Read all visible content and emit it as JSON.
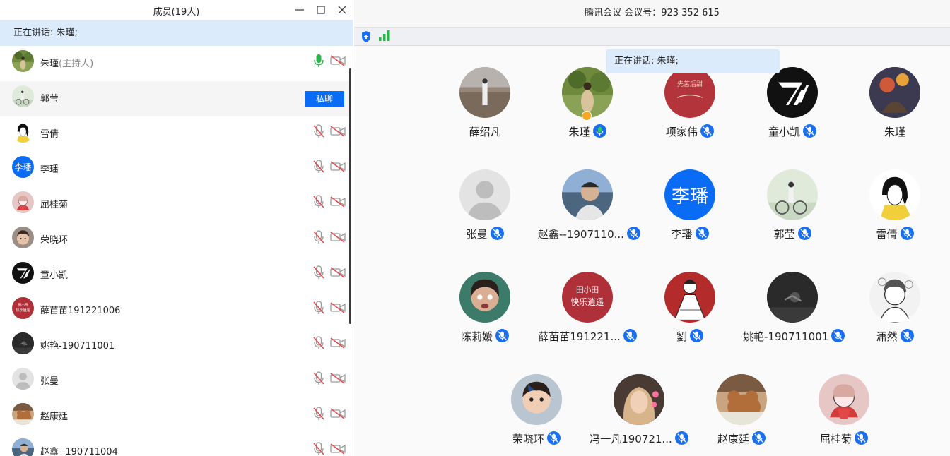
{
  "members_panel": {
    "title": "成员(19人)",
    "speaking": "正在讲话: 朱瑾;",
    "chat_button": "私聊",
    "members": [
      {
        "name": "朱瑾",
        "role": "(主持人)",
        "avatar": "photo-field",
        "mic": "active",
        "cam": "off"
      },
      {
        "name": "郭莹",
        "role": "",
        "avatar": "photo-bike",
        "mic": "none",
        "cam": "none",
        "chat": true
      },
      {
        "name": "雷倩",
        "role": "",
        "avatar": "drawing-girl-yellow",
        "mic": "off",
        "cam": "off"
      },
      {
        "name": "李璠",
        "role": "",
        "avatar": "initials",
        "initials": "李璠",
        "mic": "off",
        "cam": "off"
      },
      {
        "name": "屈桂菊",
        "role": "",
        "avatar": "drawing-pink",
        "mic": "off",
        "cam": "off"
      },
      {
        "name": "荣晓环",
        "role": "",
        "avatar": "photo-child-face",
        "mic": "off",
        "cam": "off"
      },
      {
        "name": "童小凯",
        "role": "",
        "avatar": "logo-black",
        "mic": "off",
        "cam": "off"
      },
      {
        "name": "薛苗苗191221006",
        "role": "",
        "avatar": "red-card",
        "mic": "off",
        "cam": "off"
      },
      {
        "name": "姚艳-190711001",
        "role": "",
        "avatar": "dark-photo",
        "mic": "off",
        "cam": "off"
      },
      {
        "name": "张曼",
        "role": "",
        "avatar": "default",
        "mic": "off",
        "cam": "off"
      },
      {
        "name": "赵康廷",
        "role": "",
        "avatar": "cartoon-bear",
        "mic": "off",
        "cam": "off"
      },
      {
        "name": "赵鑫--190711004",
        "role": "",
        "avatar": "photo-man",
        "mic": "off",
        "cam": "off"
      }
    ]
  },
  "meeting": {
    "title": "腾讯会议 会议号：923 352 615",
    "speaking": "正在讲话: 朱瑾;",
    "tiles": [
      {
        "name": "薛绍凡",
        "avatar": "photo-wall",
        "mic": "none"
      },
      {
        "name": "朱瑾",
        "avatar": "photo-field",
        "mic": "active",
        "host": true
      },
      {
        "name": "项家伟",
        "avatar": "red-text",
        "mic": "muted"
      },
      {
        "name": "童小凯",
        "avatar": "logo-black",
        "mic": "muted"
      },
      {
        "name": "朱瑾",
        "avatar": "photo-fruit",
        "mic": "none"
      },
      {
        "name": "张曼",
        "avatar": "default",
        "mic": "muted"
      },
      {
        "name": "赵鑫--1907110...",
        "avatar": "photo-man",
        "mic": "muted"
      },
      {
        "name": "李璠",
        "avatar": "initials",
        "initials": "李璠",
        "mic": "muted"
      },
      {
        "name": "郭莹",
        "avatar": "photo-bike",
        "mic": "muted"
      },
      {
        "name": "雷倩",
        "avatar": "drawing-girl-yellow",
        "mic": "muted"
      },
      {
        "name": "陈莉媛",
        "avatar": "photo-face",
        "mic": "muted"
      },
      {
        "name": "薛苗苗191221...",
        "avatar": "red-card",
        "mic": "muted"
      },
      {
        "name": "劉",
        "avatar": "drawing-dress",
        "mic": "muted"
      },
      {
        "name": "姚艳-190711001",
        "avatar": "dark-photo",
        "mic": "muted"
      },
      {
        "name": "潇然",
        "avatar": "drawing-boy",
        "mic": "muted"
      },
      {
        "name": "荣晓环",
        "avatar": "photo-child",
        "mic": "muted"
      },
      {
        "name": "冯一凡190721...",
        "avatar": "photo-girl-hearts",
        "mic": "muted"
      },
      {
        "name": "赵康廷",
        "avatar": "cartoon-bear",
        "mic": "muted"
      },
      {
        "name": "屈桂菊",
        "avatar": "drawing-pink",
        "mic": "muted"
      }
    ]
  },
  "colors": {
    "accent": "#0a6cf5",
    "speaking_bg": "#dcebfc",
    "mic_green": "#2bb44a",
    "muted_red": "#e0474c"
  }
}
